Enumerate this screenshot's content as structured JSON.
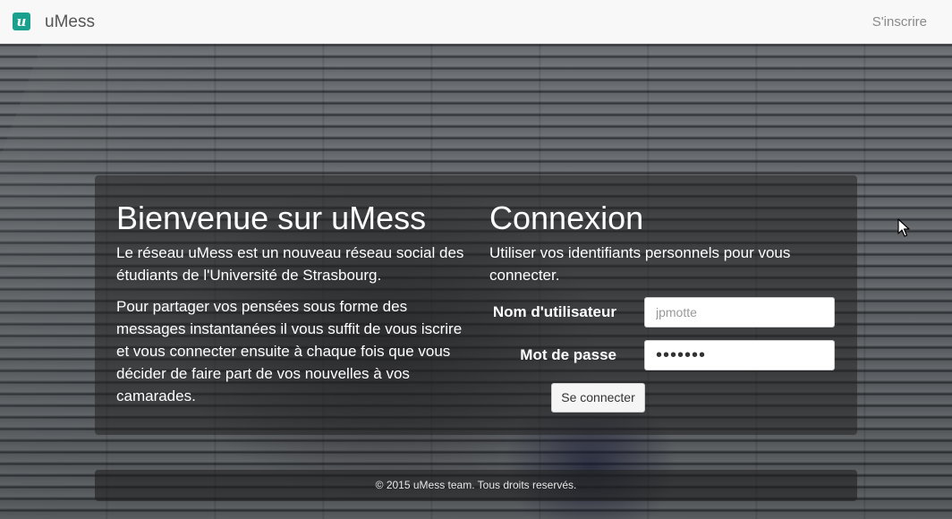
{
  "navbar": {
    "logo_letter": "u",
    "brand": "uMess",
    "signup_label": "S'inscrire"
  },
  "welcome": {
    "title": "Bienvenue sur uMess",
    "intro": "Le réseau uMess est un nouveau réseau social des étudiants de l'Université de Strasbourg.",
    "details": "Pour partager vos pensées sous forme des messages instantanées il vous suffit de vous iscrire et vous connecter ensuite à chaque fois que vous décider de faire part de vos nouvelles à vos camarades."
  },
  "login": {
    "title": "Connexion",
    "subtitle": "Utiliser vos identifiants personnels pour vous connecter.",
    "username_label": "Nom d'utilisateur",
    "username_placeholder": "jpmotte",
    "password_label": "Mot de passe",
    "password_value": "•••••••",
    "submit_label": "Se connecter"
  },
  "footer": {
    "copyright": "© 2015 uMess team. Tous droits reservés."
  },
  "colors": {
    "logo_bg": "#1aa08e",
    "navbar_bg": "#f8f8f8",
    "panel_bg": "rgba(35,35,35,0.55)"
  }
}
